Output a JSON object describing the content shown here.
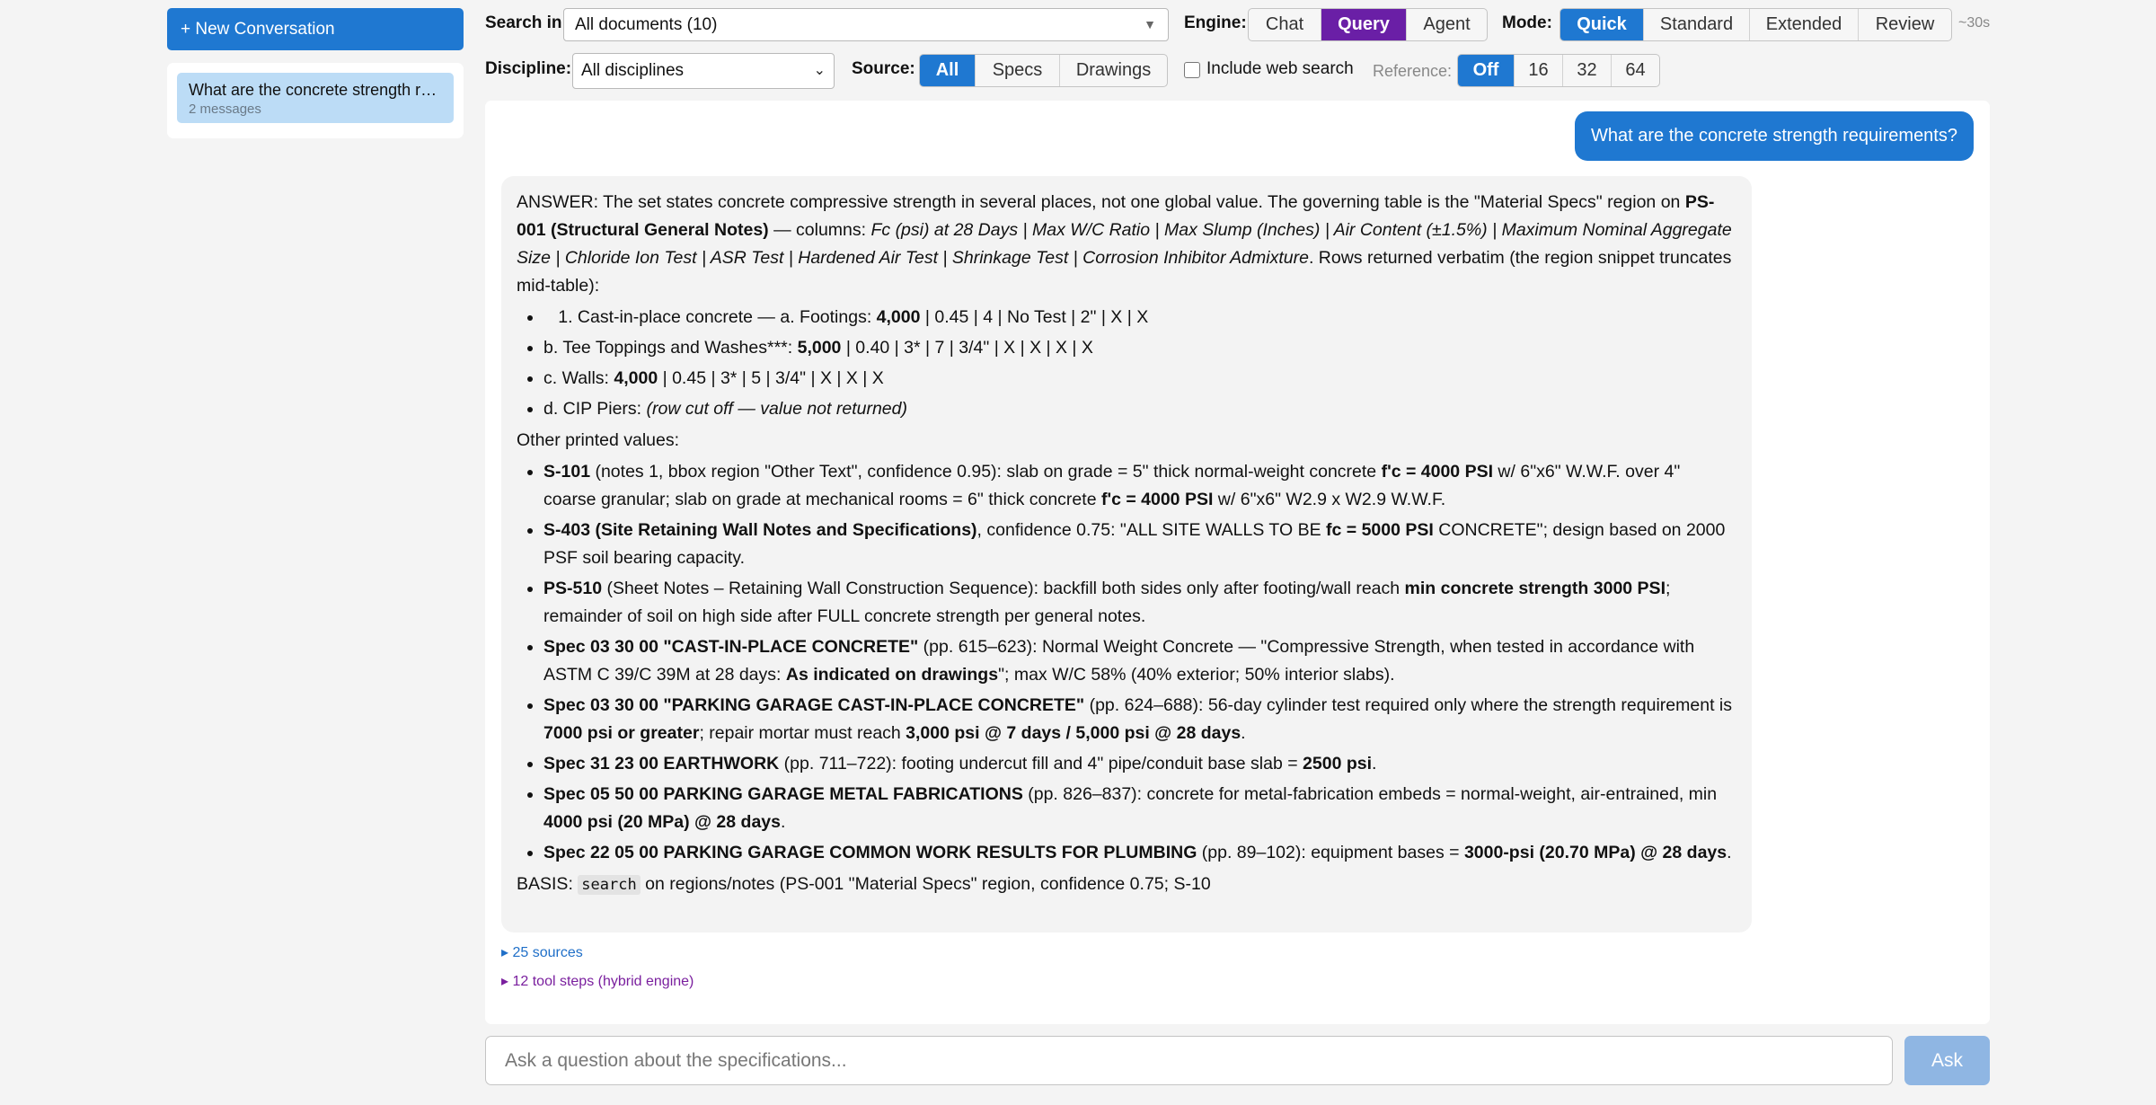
{
  "sidebar": {
    "new_conversation": "+ New Conversation",
    "conversations": [
      {
        "title": "What are the concrete strength re...",
        "subtitle": "2 messages"
      }
    ]
  },
  "toolbar": {
    "search_in_label": "Search in:",
    "search_in_value": "All documents (10)",
    "engine_label": "Engine:",
    "engine_options": [
      "Chat",
      "Query",
      "Agent"
    ],
    "engine_selected": "Query",
    "mode_label": "Mode:",
    "mode_options": [
      "Quick",
      "Standard",
      "Extended",
      "Review"
    ],
    "mode_selected": "Quick",
    "mode_hint": "~30s",
    "discipline_label": "Discipline:",
    "discipline_value": "All disciplines",
    "source_label": "Source:",
    "source_options": [
      "All",
      "Specs",
      "Drawings"
    ],
    "source_selected": "All",
    "web_search_label": "Include web search",
    "reference_label": "Reference:",
    "reference_options": [
      "Off",
      "16",
      "32",
      "64"
    ],
    "reference_selected": "Off"
  },
  "chat": {
    "user_question": "What are the concrete strength requirements?",
    "sources_link": "▸ 25 sources",
    "tool_steps_link": "▸ 12 tool steps (hybrid engine)"
  },
  "ask": {
    "placeholder": "Ask a question about the specifications...",
    "button": "Ask"
  },
  "colors": {
    "accent_blue": "#1f78d1",
    "accent_purple": "#6a1fa6",
    "sidebar_selected": "#bcdcf6",
    "ask_disabled": "#8fb6e3"
  }
}
